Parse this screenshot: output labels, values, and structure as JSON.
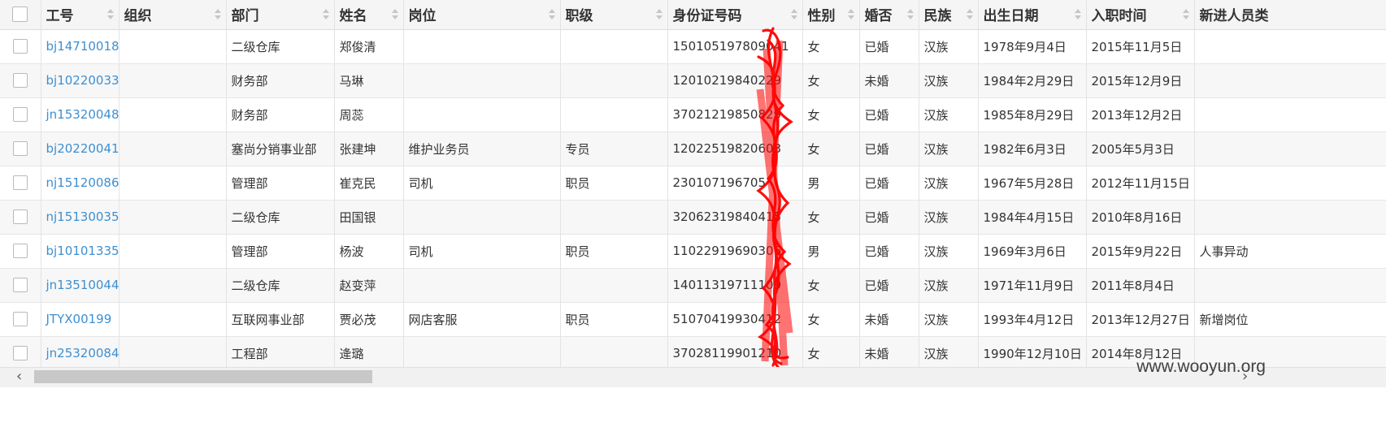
{
  "columns": [
    "工号",
    "组织",
    "部门",
    "姓名",
    "岗位",
    "职级",
    "身份证号码",
    "性别",
    "婚否",
    "民族",
    "出生日期",
    "入职时间",
    "新进人员类"
  ],
  "rows": [
    {
      "id": "bj14710018",
      "org": "",
      "dept": "二级仓库",
      "name": "郑俊清",
      "post": "",
      "level": "",
      "idcard": "150105197809041",
      "gender": "女",
      "married": "已婚",
      "ethnic": "汉族",
      "birth": "1978年9月4日",
      "join": "2015年11月5日",
      "newtype": ""
    },
    {
      "id": "bj10220033",
      "org": "",
      "dept": "财务部",
      "name": "马琳",
      "post": "",
      "level": "",
      "idcard": "12010219840229",
      "gender": "女",
      "married": "未婚",
      "ethnic": "汉族",
      "birth": "1984年2月29日",
      "join": "2015年12月9日",
      "newtype": ""
    },
    {
      "id": "jn15320048",
      "org": "",
      "dept": "财务部",
      "name": "周蕊",
      "post": "",
      "level": "",
      "idcard": "37021219850829",
      "gender": "女",
      "married": "已婚",
      "ethnic": "汉族",
      "birth": "1985年8月29日",
      "join": "2013年12月2日",
      "newtype": ""
    },
    {
      "id": "bj20220041",
      "org": "",
      "dept": "塞尚分销事业部",
      "name": "张建坤",
      "post": "维护业务员",
      "level": "专员",
      "idcard": "12022519820603",
      "gender": "女",
      "married": "已婚",
      "ethnic": "汉族",
      "birth": "1982年6月3日",
      "join": "2005年5月3日",
      "newtype": ""
    },
    {
      "id": "nj15120086",
      "org": "",
      "dept": "管理部",
      "name": "崔克民",
      "post": "司机",
      "level": "职员",
      "idcard": "230107196705",
      "gender": "男",
      "married": "已婚",
      "ethnic": "汉族",
      "birth": "1967年5月28日",
      "join": "2012年11月15日",
      "newtype": ""
    },
    {
      "id": "nj15130035",
      "org": "",
      "dept": "二级仓库",
      "name": "田国银",
      "post": "",
      "level": "",
      "idcard": "32062319840415",
      "gender": "女",
      "married": "已婚",
      "ethnic": "汉族",
      "birth": "1984年4月15日",
      "join": "2010年8月16日",
      "newtype": ""
    },
    {
      "id": "bj10101335",
      "org": "",
      "dept": "管理部",
      "name": "杨波",
      "post": "司机",
      "level": "职员",
      "idcard": "11022919690306",
      "gender": "男",
      "married": "已婚",
      "ethnic": "汉族",
      "birth": "1969年3月6日",
      "join": "2015年9月22日",
      "newtype": "人事异动"
    },
    {
      "id": "jn13510044",
      "org": "",
      "dept": "二级仓库",
      "name": "赵变萍",
      "post": "",
      "level": "",
      "idcard": "14011319711109",
      "gender": "女",
      "married": "已婚",
      "ethnic": "汉族",
      "birth": "1971年11月9日",
      "join": "2011年8月4日",
      "newtype": ""
    },
    {
      "id": "JTYX00199",
      "org": "",
      "dept": "互联网事业部",
      "name": "贾必茂",
      "post": "网店客服",
      "level": "职员",
      "idcard": "51070419930412",
      "gender": "女",
      "married": "未婚",
      "ethnic": "汉族",
      "birth": "1993年4月12日",
      "join": "2013年12月27日",
      "newtype": "新增岗位"
    },
    {
      "id": "jn25320084",
      "org": "",
      "dept": "工程部",
      "name": "逄璐",
      "post": "",
      "level": "",
      "idcard": "37028119901210",
      "gender": "女",
      "married": "未婚",
      "ethnic": "汉族",
      "birth": "1990年12月10日",
      "join": "2014年8月12日",
      "newtype": ""
    }
  ],
  "watermark": "www.wooyun.org",
  "colors": {
    "link": "#3d8fd1",
    "scribble": "#ff0000",
    "header_bg": "#f5f5f5"
  }
}
